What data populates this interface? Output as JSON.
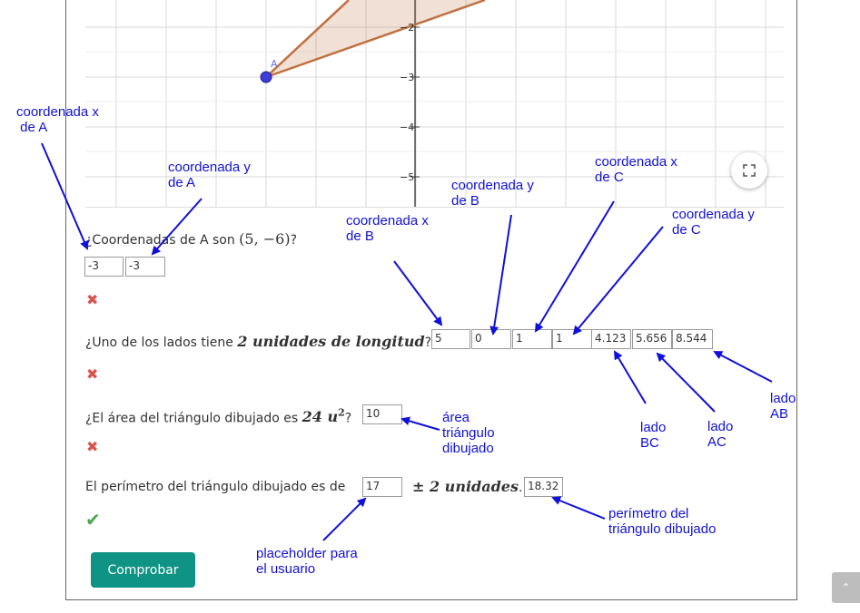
{
  "graph": {
    "y_ticks": [
      "−2",
      "−3",
      "−4",
      "−5"
    ],
    "point_label": "A",
    "fullscreen_icon": "expand-icon"
  },
  "questions": [
    {
      "text": "¿Coordenadas de A son ",
      "math": "(5, −6)",
      "suffix": "?",
      "inputs": [
        "-3",
        "-3"
      ],
      "result": "wrong",
      "mark": "✖"
    },
    {
      "text": "¿Uno de los lados tiene ",
      "math": "2 unidades de longitud",
      "suffix": "?",
      "inputs": [
        "5",
        "0",
        "1",
        "1",
        "4.123",
        "5.656",
        "8.544"
      ],
      "result": "wrong",
      "mark": "✖"
    },
    {
      "text": "¿El área del triángulo dibujado es ",
      "math": "24 u",
      "math_sup": "2",
      "suffix": "?",
      "inputs": [
        "10"
      ],
      "result": "wrong",
      "mark": "✖"
    },
    {
      "text": "El perímetro del triángulo dibujado es de",
      "math": "± 2 unidades",
      "suffix": ".",
      "inputs": [
        "17",
        "18.32"
      ],
      "result": "correct",
      "mark": "✔"
    }
  ],
  "submit_label": "Comprobar",
  "annotations": {
    "ax": "coordenada x\n de A",
    "ay": "coordenada y\nde A",
    "bx": "coordenada x\nde B",
    "by": "coordenada y\nde B",
    "cx": "coordenada x\nde C",
    "cy": "coordenada y\nde C",
    "bc": "lado\nBC",
    "ac": "lado\nAC",
    "ab": "lado\nAB",
    "area": "área\ntriángulo\ndibujado",
    "perim": "perímetro del\ntriángulo dibujado",
    "placeholder": "placeholder para\nel usuario"
  },
  "colors": {
    "accent": "#0e9384",
    "annotation": "#1010d8",
    "wrong": "#d9534f",
    "correct": "#4aa74a",
    "triangle_stroke": "#c0703f",
    "point": "#3d3dd6"
  }
}
